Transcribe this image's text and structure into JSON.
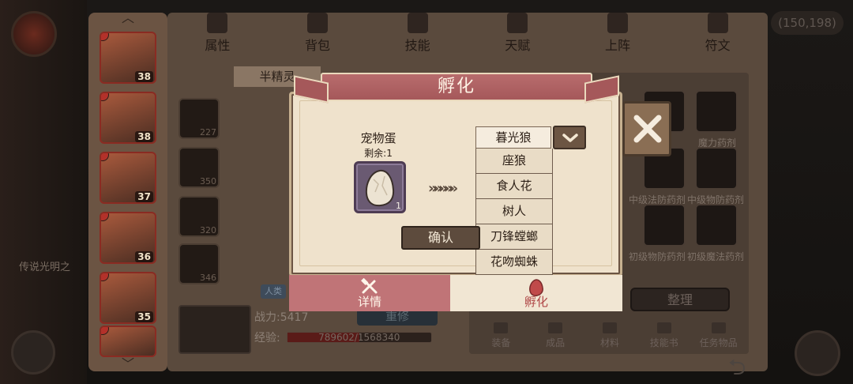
{
  "top_tabs": [
    "属性",
    "背包",
    "技能",
    "天赋",
    "上阵",
    "符文"
  ],
  "coins": "(150,198)",
  "hero_list": {
    "levels": [
      "38",
      "38",
      "37",
      "36",
      "35",
      ""
    ]
  },
  "hero": {
    "name": "半精灵",
    "race_tag": "人类",
    "power_label": "战力:5417",
    "exp_label": "经验:",
    "exp_value": "789602/1568340",
    "exp_fraction": 0.503,
    "retrain_label": "重修"
  },
  "equip_counts": [
    "227",
    "350",
    "320",
    "346"
  ],
  "inventory": {
    "item_labels": [
      "魔力药剂",
      "中级法防药剂",
      "中级物防药剂",
      "初级物防药剂",
      "初级魔法药剂"
    ],
    "sort_label": "整理",
    "categories": [
      "装备",
      "成品",
      "材料",
      "技能书",
      "任务物品"
    ]
  },
  "background_text": "传说光明之",
  "dialog": {
    "title": "孵化",
    "egg_name": "宠物蛋",
    "egg_remaining": "剩余:1",
    "egg_count": "1",
    "chevrons": "»»»»»",
    "selected_option": "暮光狼",
    "options": [
      "座狼",
      "食人花",
      "树人",
      "刀锋螳螂",
      "花吻蜘蛛"
    ],
    "confirm_label": "确认",
    "tabs": {
      "detail": "详情",
      "hatch": "孵化"
    }
  },
  "colors": {
    "banner": "#a5585a",
    "parchment": "#efe2cc",
    "tab_active": "#b04848"
  },
  "icons": {
    "close": "close-icon",
    "dropdown": "chevron-down-icon",
    "detail_tab": "hammer-wrench-icon",
    "hatch_tab": "egg-icon"
  }
}
